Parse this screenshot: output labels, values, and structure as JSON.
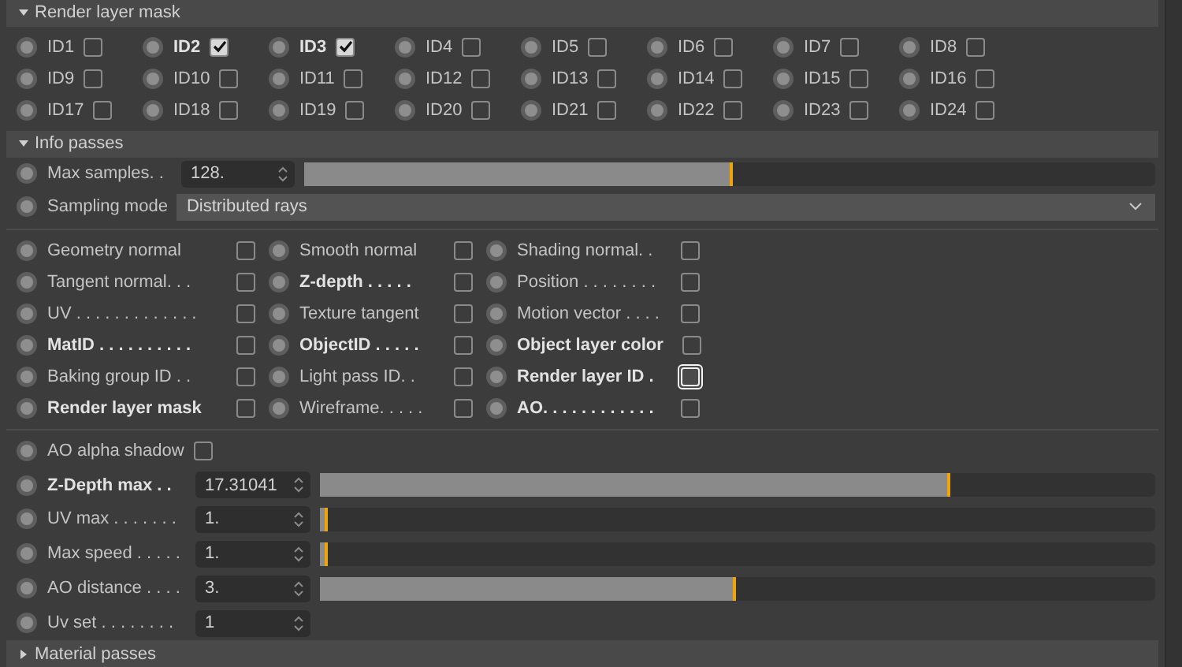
{
  "render_layer_mask": {
    "title": "Render layer mask",
    "expanded": true,
    "ids": [
      {
        "label": "ID1",
        "checked": false
      },
      {
        "label": "ID2",
        "checked": true
      },
      {
        "label": "ID3",
        "checked": true
      },
      {
        "label": "ID4",
        "checked": false
      },
      {
        "label": "ID5",
        "checked": false
      },
      {
        "label": "ID6",
        "checked": false
      },
      {
        "label": "ID7",
        "checked": false
      },
      {
        "label": "ID8",
        "checked": false
      },
      {
        "label": "ID9",
        "checked": false
      },
      {
        "label": "ID10",
        "checked": false
      },
      {
        "label": "ID11",
        "checked": false
      },
      {
        "label": "ID12",
        "checked": false
      },
      {
        "label": "ID13",
        "checked": false
      },
      {
        "label": "ID14",
        "checked": false
      },
      {
        "label": "ID15",
        "checked": false
      },
      {
        "label": "ID16",
        "checked": false
      },
      {
        "label": "ID17",
        "checked": false
      },
      {
        "label": "ID18",
        "checked": false
      },
      {
        "label": "ID19",
        "checked": false
      },
      {
        "label": "ID20",
        "checked": false
      },
      {
        "label": "ID21",
        "checked": false
      },
      {
        "label": "ID22",
        "checked": false
      },
      {
        "label": "ID23",
        "checked": false
      },
      {
        "label": "ID24",
        "checked": false
      }
    ]
  },
  "info_passes": {
    "title": "Info passes",
    "expanded": true,
    "max_samples": {
      "label": "Max samples. .",
      "value": "128.",
      "level": 0.5
    },
    "sampling_mode": {
      "label": "Sampling mode",
      "value": "Distributed rays"
    },
    "passes": [
      {
        "label": "Geometry normal",
        "checked": false,
        "emphasized": false,
        "focused": false
      },
      {
        "label": "Smooth normal",
        "checked": false,
        "emphasized": false,
        "focused": false
      },
      {
        "label": "Shading normal. .",
        "checked": false,
        "emphasized": false,
        "focused": false
      },
      {
        "label": "Tangent normal. . .",
        "checked": false,
        "emphasized": false,
        "focused": false
      },
      {
        "label": "Z-depth . . . . .",
        "checked": false,
        "emphasized": true,
        "focused": false
      },
      {
        "label": "Position . . . . . . . .",
        "checked": false,
        "emphasized": false,
        "focused": false
      },
      {
        "label": "UV . . . . . . . . . . . . .",
        "checked": false,
        "emphasized": false,
        "focused": false
      },
      {
        "label": "Texture tangent",
        "checked": false,
        "emphasized": false,
        "focused": false
      },
      {
        "label": "Motion vector . . . .",
        "checked": false,
        "emphasized": false,
        "focused": false
      },
      {
        "label": "MatID . . . . . . . . . .",
        "checked": false,
        "emphasized": true,
        "focused": false
      },
      {
        "label": "ObjectID . . . . .",
        "checked": false,
        "emphasized": true,
        "focused": false
      },
      {
        "label": "Object layer color",
        "checked": false,
        "emphasized": true,
        "focused": false
      },
      {
        "label": "Baking group ID . .",
        "checked": false,
        "emphasized": false,
        "focused": false
      },
      {
        "label": "Light pass ID. .",
        "checked": false,
        "emphasized": false,
        "focused": false
      },
      {
        "label": "Render layer ID .",
        "checked": false,
        "emphasized": true,
        "focused": true
      },
      {
        "label": "Render layer mask",
        "checked": false,
        "emphasized": true,
        "focused": false
      },
      {
        "label": "Wireframe. . . . .",
        "checked": false,
        "emphasized": false,
        "focused": false
      },
      {
        "label": "AO. . . . . . . . . . . .",
        "checked": false,
        "emphasized": true,
        "focused": false
      }
    ],
    "ao_alpha_shadow": {
      "label": "AO alpha shadow",
      "checked": false
    },
    "parameters": [
      {
        "kind": "slider",
        "label": "Z-Depth max . .",
        "value": "17.31041",
        "level": 0.75,
        "emphasized": true
      },
      {
        "kind": "slider",
        "label": "UV max . . . . . . .",
        "value": "1.",
        "level": 0.005,
        "emphasized": false
      },
      {
        "kind": "slider",
        "label": "Max speed . . . . .",
        "value": "1.",
        "level": 0.005,
        "emphasized": false
      },
      {
        "kind": "slider",
        "label": "AO distance . . . .",
        "value": "3.",
        "level": 0.495,
        "emphasized": false
      },
      {
        "kind": "spin",
        "label": "Uv set . . . . . . . .",
        "value": "1",
        "emphasized": false
      }
    ]
  },
  "material_passes": {
    "title": "Material passes",
    "expanded": false
  }
}
